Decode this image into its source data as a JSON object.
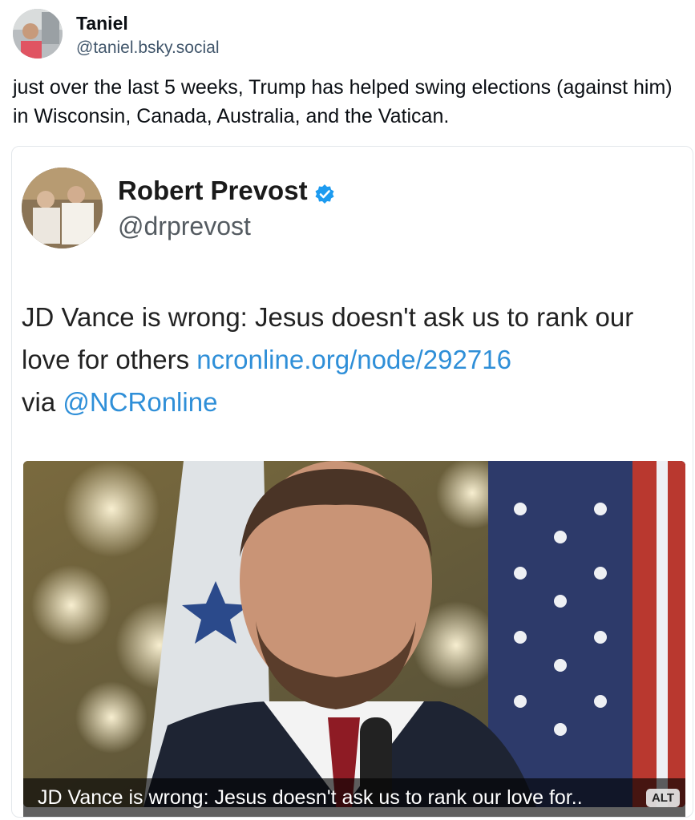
{
  "post": {
    "author_name": "Taniel",
    "author_handle": "@taniel.bsky.social",
    "text": "just over the last 5 weeks, Trump has helped swing elections (against him) in Wisconsin, Canada, Australia, and the Vatican."
  },
  "embedded_tweet": {
    "author_name": "Robert Prevost",
    "author_handle": "@drprevost",
    "text_main": "JD Vance is wrong: Jesus doesn't ask us to rank our love for others ",
    "link": "ncronline.org/node/292716",
    "text_via": "via ",
    "mention": "@NCRonline",
    "image_caption": "JD Vance is wrong: Jesus doesn't ask us to rank our love for..",
    "alt_badge": "ALT"
  },
  "colors": {
    "link": "#2f8fd8",
    "verified": "#1d9bf0",
    "handle_gray": "#42576c"
  },
  "icons": {
    "verified": "verified-badge-icon"
  }
}
